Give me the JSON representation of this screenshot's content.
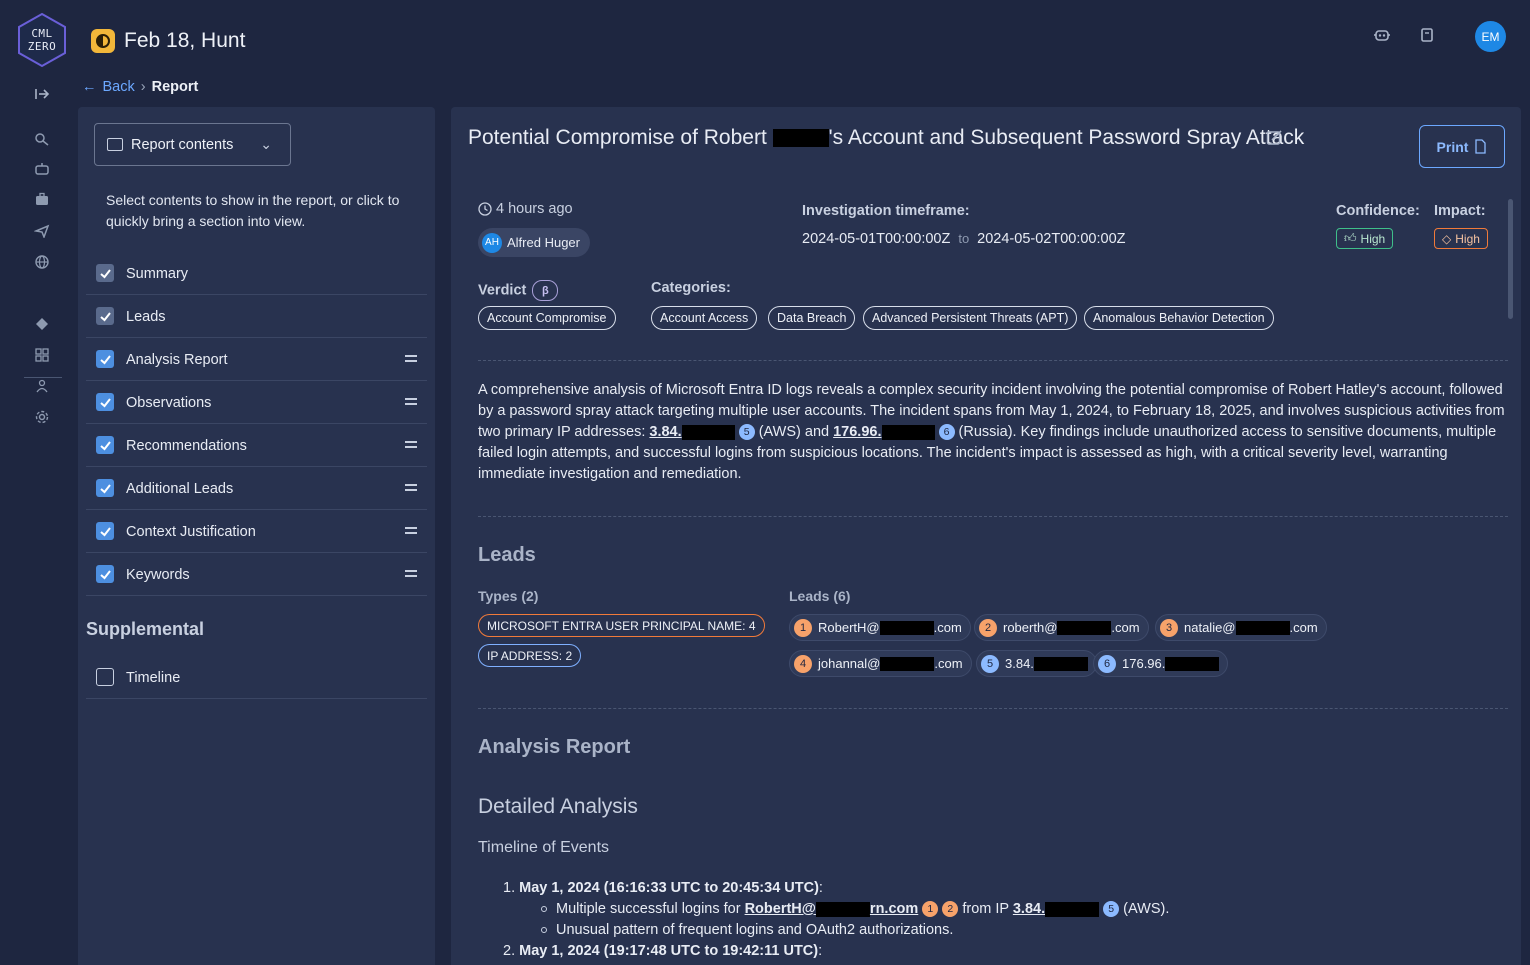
{
  "app": {
    "logo_text_top": "CML",
    "logo_text_bottom": "ZERO",
    "hunt_title": "Feb 18, Hunt",
    "user_initials": "EM"
  },
  "breadcrumb": {
    "back": "Back",
    "current": "Report"
  },
  "left_panel": {
    "dropdown_label": "Report contents",
    "description": "Select contents to show in the report, or click to quickly bring a section into view.",
    "sections": [
      {
        "label": "Summary",
        "checked": true,
        "locked": true
      },
      {
        "label": "Leads",
        "checked": true,
        "locked": true
      },
      {
        "label": "Analysis Report",
        "checked": true
      },
      {
        "label": "Observations",
        "checked": true
      },
      {
        "label": "Recommendations",
        "checked": true
      },
      {
        "label": "Additional Leads",
        "checked": true
      },
      {
        "label": "Context Justification",
        "checked": true
      },
      {
        "label": "Keywords",
        "checked": true
      }
    ],
    "supplemental_title": "Supplemental",
    "supplemental": [
      {
        "label": "Timeline",
        "checked": false
      }
    ]
  },
  "report": {
    "title_before": "Potential Compromise of Robert",
    "title_after": "'s Account and Subsequent Password Spray Attack",
    "print_label": "Print",
    "time_ago": "4 hours ago",
    "author_initials": "AH",
    "author_name": "Alfred Huger",
    "timeframe_label": "Investigation timeframe:",
    "timeframe_start": "2024-05-01T00:00:00Z",
    "timeframe_to": "to",
    "timeframe_end": "2024-05-02T00:00:00Z",
    "confidence_label": "Confidence:",
    "confidence_value": "High",
    "impact_label": "Impact:",
    "impact_value": "High",
    "verdict_label": "Verdict",
    "verdict_beta": "β",
    "verdict_value": "Account Compromise",
    "categories_label": "Categories:",
    "categories": [
      "Account Access",
      "Data Breach",
      "Advanced Persistent Threats (APT)",
      "Anomalous Behavior Detection"
    ],
    "summary": {
      "p1": "A comprehensive analysis of Microsoft Entra ID logs reveals a complex security incident involving the potential compromise of Robert Hatley's account, followed by a password spray attack targeting multiple user accounts. The incident spans from May 1, 2024, to February 18, 2025, and involves suspicious activities from two primary IP addresses: ",
      "ip1": "3.84.",
      "ip1_ref": "5",
      "mid1": " (AWS) and ",
      "ip2": "176.96.",
      "ip2_ref": "6",
      "p2": " (Russia). Key findings include unauthorized access to sensitive documents, multiple failed login attempts, and successful logins from suspicious locations. The incident's impact is assessed as high, with a critical severity level, warranting immediate investigation and remediation."
    },
    "leads_section": {
      "title": "Leads",
      "types_label": "Types (2)",
      "types": [
        "MICROSOFT ENTRA USER PRINCIPAL NAME: 4",
        "IP ADDRESS: 2"
      ],
      "leads_label": "Leads (6)",
      "leads": [
        {
          "num": "1",
          "pre": "RobertH@",
          "post": ".com",
          "color": "orange"
        },
        {
          "num": "2",
          "pre": "roberth@",
          "post": ".com",
          "color": "orange"
        },
        {
          "num": "3",
          "pre": "natalie@",
          "post": ".com",
          "color": "orange"
        },
        {
          "num": "4",
          "pre": "johannal@",
          "post": ".com",
          "color": "orange"
        },
        {
          "num": "5",
          "pre": "3.84.",
          "post": "",
          "color": "blue"
        },
        {
          "num": "6",
          "pre": "176.96.",
          "post": "",
          "color": "blue"
        }
      ]
    },
    "analysis": {
      "title": "Analysis Report",
      "detailed": "Detailed Analysis",
      "timeline_heading": "Timeline of Events",
      "item1_num": "1.",
      "item1_title": "May 1, 2024 (16:16:33 UTC to 20:45:34 UTC)",
      "item1_b1_pre": "Multiple successful logins for ",
      "item1_b1_user_a": "RobertH@",
      "item1_b1_user_b": "rn.com",
      "item1_b1_ref_a": "1",
      "item1_b1_ref_b": "2",
      "item1_b1_mid": " from IP ",
      "item1_b1_ip": "3.84.",
      "item1_b1_ip_ref": "5",
      "item1_b1_post": " (AWS).",
      "item1_b2": "Unusual pattern of frequent logins and OAuth2 authorizations.",
      "item2_num": "2.",
      "item2_title": "May 1, 2024 (19:17:48 UTC to 19:42:11 UTC)"
    }
  }
}
